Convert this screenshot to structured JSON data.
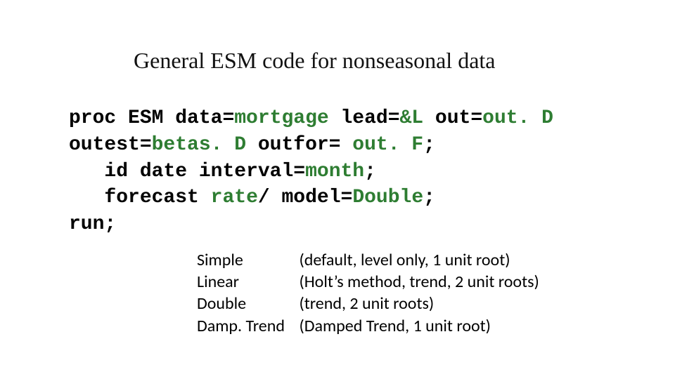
{
  "title": "General ESM code for nonseasonal data",
  "code": {
    "tokens": [
      {
        "t": "proc ",
        "c": "blk"
      },
      {
        "t": "ESM ",
        "c": "blk"
      },
      {
        "t": "data=",
        "c": "blk"
      },
      {
        "t": "mortgage ",
        "c": "grn"
      },
      {
        "t": "lead=",
        "c": "blk"
      },
      {
        "t": "&L ",
        "c": "grn"
      },
      {
        "t": "out=",
        "c": "blk"
      },
      {
        "t": "out. D",
        "c": "grn"
      },
      {
        "t": "\n",
        "c": "blk"
      },
      {
        "t": "outest=",
        "c": "blk"
      },
      {
        "t": "betas. D ",
        "c": "grn"
      },
      {
        "t": "outfor= ",
        "c": "blk"
      },
      {
        "t": "out. F",
        "c": "grn"
      },
      {
        "t": ";",
        "c": "blk"
      },
      {
        "t": "\n   ",
        "c": "blk"
      },
      {
        "t": "id ",
        "c": "blk"
      },
      {
        "t": "date ",
        "c": "blk"
      },
      {
        "t": "interval=",
        "c": "blk"
      },
      {
        "t": "month",
        "c": "grn"
      },
      {
        "t": ";",
        "c": "blk"
      },
      {
        "t": "\n   ",
        "c": "blk"
      },
      {
        "t": "forecast ",
        "c": "blk"
      },
      {
        "t": "rate",
        "c": "grn"
      },
      {
        "t": "/ ",
        "c": "blk"
      },
      {
        "t": "model=",
        "c": "blk"
      },
      {
        "t": "Double",
        "c": "grn"
      },
      {
        "t": ";",
        "c": "blk"
      },
      {
        "t": "\n",
        "c": "blk"
      },
      {
        "t": "run",
        "c": "blk"
      },
      {
        "t": ";",
        "c": "blk"
      }
    ]
  },
  "models": [
    {
      "name": "Simple",
      "desc": "(default, level only, 1 unit root)"
    },
    {
      "name": "Linear",
      "desc": "(Holt’s method, trend, 2 unit roots)"
    },
    {
      "name": "Double",
      "desc": "(trend, 2 unit roots)"
    },
    {
      "name": "Damp. Trend",
      "desc": "(Damped Trend, 1 unit root)"
    }
  ]
}
